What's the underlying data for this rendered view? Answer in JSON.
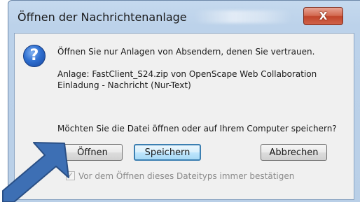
{
  "dialog": {
    "title": "Öffnen der Nachrichtenanlage",
    "close_label": "X",
    "icon": "question-icon",
    "message": "Öffnen Sie nur Anlagen von Absendern, denen Sie vertrauen.",
    "attachment_line1": "Anlage: FastClient_S24.zip von OpenScape Web Collaboration",
    "attachment_line2": "Einladung - Nachricht (Nur-Text)",
    "question": "Möchten Sie die Datei öffnen oder auf Ihrem Computer speichern?",
    "buttons": {
      "open": "Öffnen",
      "save": "Speichern",
      "cancel": "Abbrechen"
    },
    "checkbox": {
      "label": "Vor dem Öffnen dieses Dateityps immer bestätigen",
      "checked": true,
      "disabled": true
    }
  },
  "annotation": {
    "arrow_color": "#3d6fb4",
    "target": "open-button"
  },
  "colors": {
    "close_button": "#c7452b",
    "frame": "#bcd2ea",
    "focus_border": "#3c7fb1"
  }
}
